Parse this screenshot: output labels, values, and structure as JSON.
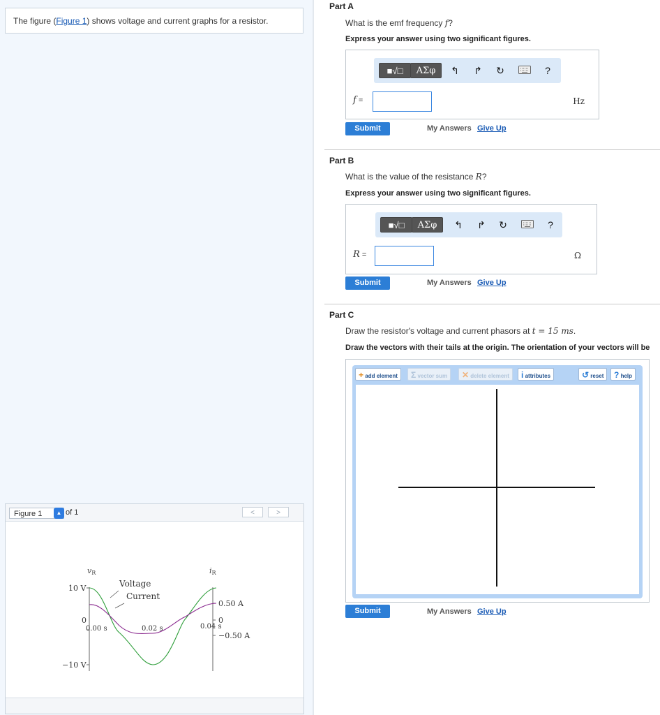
{
  "intro": {
    "before": "The figure (",
    "link": "Figure 1",
    "after": ") shows voltage and current graphs for a resistor."
  },
  "figure_panel": {
    "select_value": "Figure 1",
    "of_label": "of 1",
    "prev_label": "<",
    "next_label": ">",
    "graph": {
      "vr_label": "v",
      "vr_sub": "R",
      "ir_label": "i",
      "ir_sub": "R",
      "v_max": "10 V",
      "v_zero": "0",
      "v_min": "−10 V",
      "i_max": "0.50 A",
      "i_zero": "0",
      "i_min": "−0.50 A",
      "t0": "0.00 s",
      "t1": "0.02 s",
      "t2": "0.04 s",
      "voltage_label": "Voltage",
      "current_label": "Current",
      "voltage_color": "#2e9e3a",
      "current_color": "#8a2a8f"
    }
  },
  "partA": {
    "title": "Part A",
    "question": "What is the emf frequency",
    "symbol": "f",
    "qmark": "?",
    "instruction": "Express your answer using two significant figures.",
    "var": "f",
    "eq": " =",
    "unit": "Hz",
    "submit": "Submit",
    "my_answers": "My Answers",
    "give_up": "Give Up"
  },
  "partB": {
    "title": "Part B",
    "question": "What is the value of the resistance",
    "symbol": "R",
    "qmark": "?",
    "instruction": "Express your answer using two significant figures.",
    "var": "R",
    "eq": " =",
    "unit": "Ω",
    "submit": "Submit",
    "my_answers": "My Answers",
    "give_up": "Give Up"
  },
  "partC": {
    "title": "Part C",
    "question": "Draw the resistor's voltage and current phasors at",
    "t_expr": "t = 15 ms",
    "period": ".",
    "instruction": "Draw the vectors with their tails at the origin. The orientation of your vectors will be",
    "tools": {
      "add": "add element",
      "vsum": "vector sum",
      "del": "delete element",
      "attr": "attributes",
      "reset": "reset",
      "help": "help"
    },
    "submit": "Submit",
    "my_answers": "My Answers",
    "give_up": "Give Up"
  },
  "toolbar": {
    "math": "■√□",
    "greek": "ΑΣφ",
    "help": "?"
  },
  "colors": {
    "accent": "#2c7ed6",
    "link": "#1a5bb5",
    "panel_bg": "#f2f7fd"
  }
}
